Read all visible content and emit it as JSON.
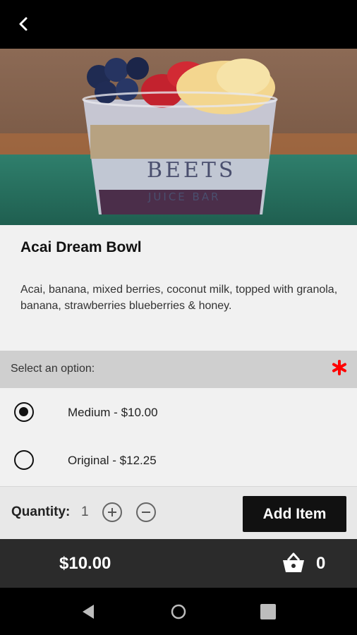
{
  "topbar": {
    "back_icon": "chevron-left-icon"
  },
  "product": {
    "image_alt": "",
    "bowl_text_main": "BEETS",
    "bowl_text_sub": "JUICE BAR",
    "title": "Acai Dream Bowl",
    "description": "Acai, banana, mixed berries, coconut milk, topped with granola, banana, strawberries blueberries & honey."
  },
  "options": {
    "header": "Select an option:",
    "required_color": "#ff0000",
    "items": [
      {
        "label": "Medium - $10.00",
        "selected": true
      },
      {
        "label": "Original - $12.25",
        "selected": false
      }
    ]
  },
  "quantity": {
    "label": "Quantity:",
    "value": "1",
    "increment_icon": "plus-circle-icon",
    "decrement_icon": "minus-circle-icon"
  },
  "add_button": {
    "label": "Add Item"
  },
  "total": {
    "price": "$10.00",
    "cart_icon": "basket-icon",
    "cart_count": "0"
  },
  "system_nav": {
    "back_icon": "nav-back-icon",
    "home_icon": "nav-home-icon",
    "recents_icon": "nav-recents-icon"
  }
}
